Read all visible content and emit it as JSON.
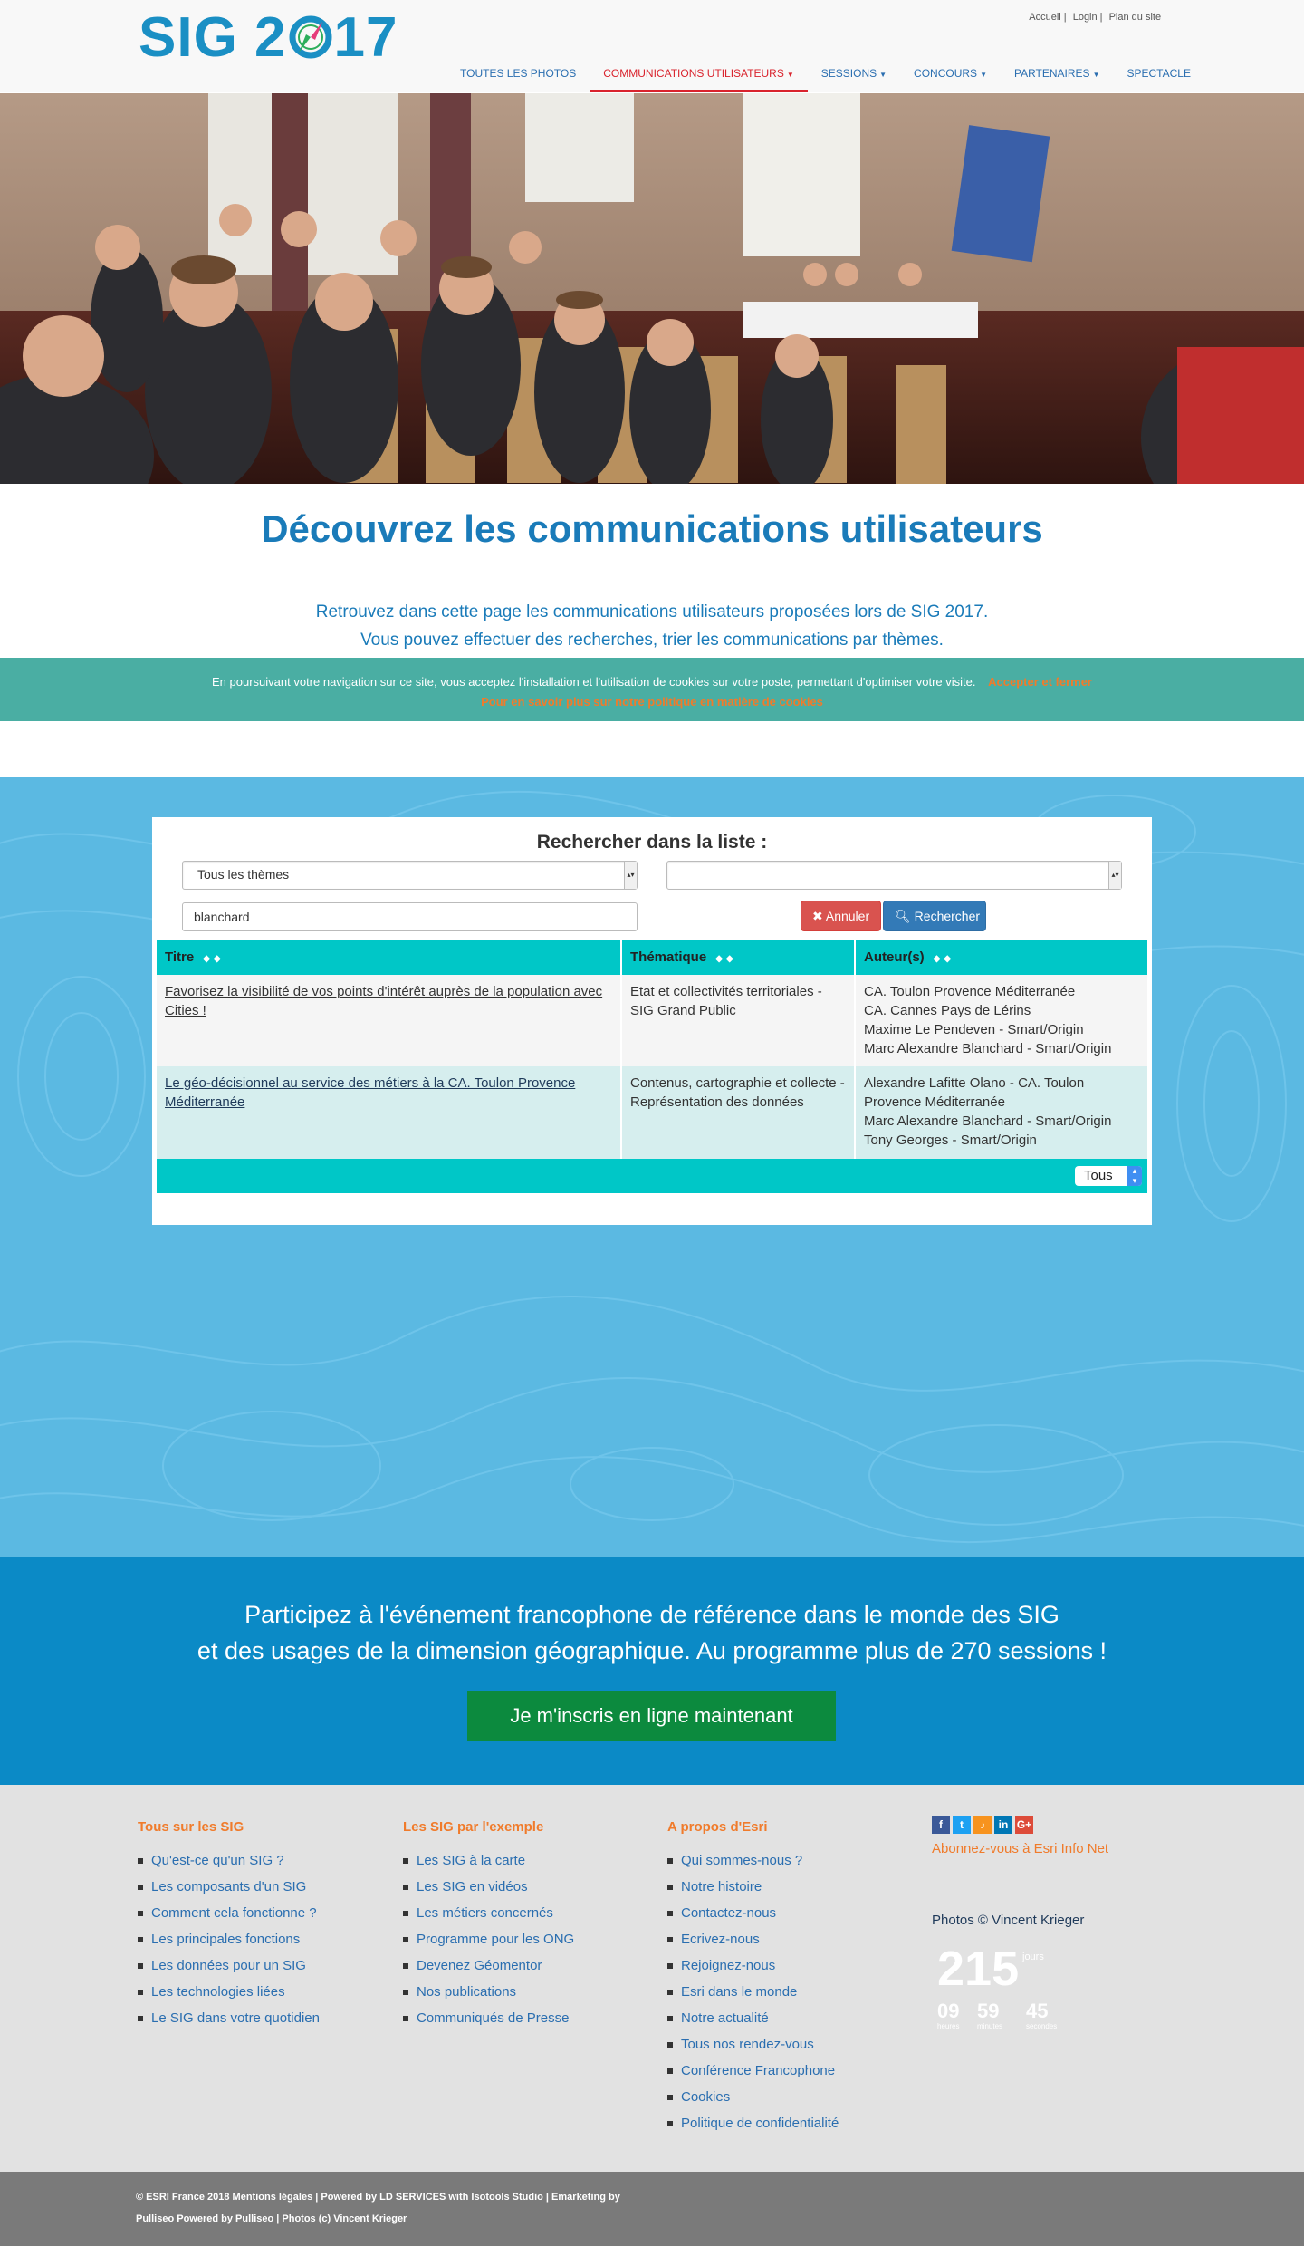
{
  "header": {
    "logo_text_1": "SIG 2",
    "logo_text_2": "17",
    "toplinks": [
      "Accueil |",
      "Login |",
      "Plan du site |"
    ],
    "nav": [
      {
        "label": "TOUTES LES PHOTOS",
        "dropdown": false
      },
      {
        "label": "COMMUNICATIONS UTILISATEURS",
        "dropdown": true,
        "active": true
      },
      {
        "label": "SESSIONS",
        "dropdown": true
      },
      {
        "label": "CONCOURS",
        "dropdown": true
      },
      {
        "label": "PARTENAIRES",
        "dropdown": true
      },
      {
        "label": "SPECTACLE",
        "dropdown": false
      }
    ]
  },
  "intro": {
    "title": "Découvrez les communications utilisateurs",
    "line1": "Retrouvez dans cette page les communications utilisateurs proposées lors de SIG 2017.",
    "line2": "Vous pouvez effectuer des recherches, trier les communications par thèmes."
  },
  "cookie": {
    "text": "En poursuivant votre navigation sur ce site, vous acceptez l'installation et l'utilisation de cookies sur votre poste, permettant d'optimiser votre visite.",
    "accept": "Accepter et fermer",
    "policy": "Pour en savoir plus sur notre politique en matière de cookies"
  },
  "search": {
    "title": "Rechercher dans la liste :",
    "theme_select": "Tous les thèmes",
    "second_select": "",
    "query": "blanchard",
    "cancel_label": "Annuler",
    "search_label": "Rechercher"
  },
  "table": {
    "headers": [
      "Titre",
      "Thématique",
      "Auteur(s)"
    ],
    "rows": [
      {
        "title": "Favorisez la visibilité de vos points d'intérêt auprès de la population avec Cities !",
        "theme": "Etat et collectivités territoriales - SIG Grand Public",
        "authors": [
          "CA. Toulon Provence Méditerranée",
          "CA. Cannes Pays de Lérins",
          "Maxime Le Pendeven - Smart/Origin",
          "Marc Alexandre Blanchard - Smart/Origin"
        ]
      },
      {
        "title": "Le géo-décisionnel au service des métiers à la CA. Toulon Provence Méditerranée",
        "theme": "Contenus, cartographie et collecte - Représentation des données",
        "authors": [
          "Alexandre Lafitte Olano - CA. Toulon Provence Méditerranée",
          "Marc Alexandre Blanchard - Smart/Origin",
          "Tony Georges - Smart/Origin"
        ]
      }
    ],
    "page_size": "Tous"
  },
  "cta": {
    "line1": "Participez à l'événement francophone de référence dans le monde des SIG",
    "line2": "et des usages de la dimension géographique. Au programme plus de 270 sessions !",
    "button": "Je m'inscris en ligne maintenant"
  },
  "footer": {
    "col1": {
      "title": "Tous sur les SIG",
      "items": [
        "Qu'est-ce qu'un SIG ?",
        "Les composants d'un SIG",
        "Comment cela fonctionne ?",
        "Les principales fonctions",
        "Les données pour un SIG",
        "Les technologies liées",
        "Le SIG dans votre quotidien"
      ]
    },
    "col2": {
      "title": "Les SIG par l'exemple",
      "items": [
        "Les SIG à la carte",
        "Les SIG en vidéos",
        "Les métiers concernés",
        "Programme pour les ONG",
        "Devenez Géomentor",
        "Nos publications",
        "Communiqués de Presse"
      ]
    },
    "col3": {
      "title": "A propos d'Esri",
      "items": [
        "Qui sommes-nous ?",
        "Notre histoire",
        "Contactez-nous",
        "Ecrivez-nous",
        "Rejoignez-nous",
        "Esri dans le monde",
        "Notre actualité",
        "Tous nos rendez-vous",
        "Conférence Francophone",
        "Cookies",
        "Politique de confidentialité"
      ]
    },
    "social": [
      "f",
      "t",
      "♪",
      "in",
      "G+"
    ],
    "social_colors": [
      "#3b5998",
      "#1da1f2",
      "#f7931e",
      "#0077b5",
      "#dd4b39"
    ],
    "subscribe": "Abonnez-vous à Esri Info Net",
    "photos": "Photos © Vincent Krieger",
    "countdown": {
      "days": "215",
      "days_label": "jours",
      "hours": "09",
      "minutes": "59",
      "seconds": "45",
      "hours_label": "heures",
      "minutes_label": "minutes",
      "seconds_label": "secondes"
    }
  },
  "bottom": {
    "line1": "© ESRI France 2018  Mentions légales |   Powered by LD SERVICES with Isotools Studio |   Emarketing by",
    "line2": "Pulliseo Powered by Pulliseo |   Photos (c) Vincent Krieger"
  }
}
